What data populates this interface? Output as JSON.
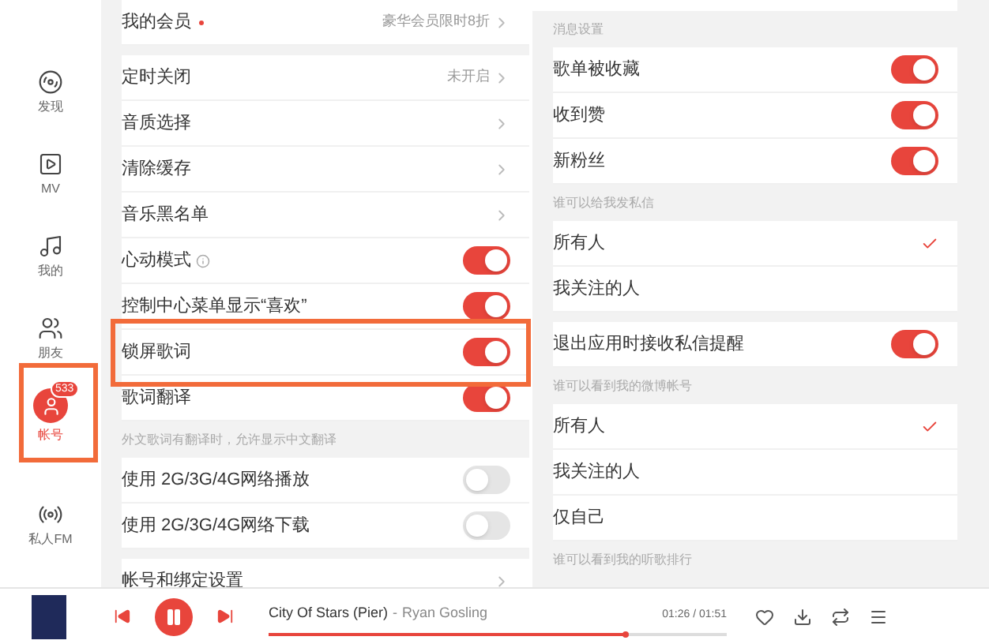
{
  "sidebar": {
    "items": [
      {
        "label": "发现",
        "selected": false
      },
      {
        "label": "MV",
        "selected": false
      },
      {
        "label": "我的",
        "selected": false
      },
      {
        "label": "朋友",
        "selected": false
      },
      {
        "label": "帐号",
        "selected": true,
        "badge": "533"
      },
      {
        "label": "私人FM",
        "selected": false
      }
    ]
  },
  "settings_left": {
    "sections": [
      {
        "rows": [
          {
            "kind": "link",
            "label": "我的会员",
            "dot": true,
            "value": "豪华会员限时8折"
          }
        ]
      },
      {
        "rows": [
          {
            "kind": "link",
            "label": "定时关闭",
            "value": "未开启"
          },
          {
            "kind": "link",
            "label": "音质选择"
          },
          {
            "kind": "link",
            "label": "清除缓存"
          },
          {
            "kind": "link",
            "label": "音乐黑名单"
          },
          {
            "kind": "toggle",
            "label": "心动模式",
            "info": true,
            "on": true
          },
          {
            "kind": "toggle",
            "label": "控制中心菜单显示“喜欢”",
            "on": true
          },
          {
            "kind": "toggle",
            "label": "锁屏歌词",
            "on": true
          },
          {
            "kind": "toggle",
            "label": "歌词翻译",
            "on": true
          }
        ]
      },
      {
        "header": "外文歌词有翻译时，允许显示中文翻译",
        "rows": [
          {
            "kind": "toggle",
            "label": "使用 2G/3G/4G网络播放",
            "on": false
          },
          {
            "kind": "toggle",
            "label": "使用 2G/3G/4G网络下载",
            "on": false
          }
        ]
      },
      {
        "rows": [
          {
            "kind": "link",
            "label": "帐号和绑定设置"
          }
        ]
      }
    ]
  },
  "settings_right": {
    "sections": [
      {
        "header": "消息设置",
        "rows": [
          {
            "kind": "toggle",
            "label": "歌单被收藏",
            "on": true
          },
          {
            "kind": "toggle",
            "label": "收到赞",
            "on": true
          },
          {
            "kind": "toggle",
            "label": "新粉丝",
            "on": true
          }
        ]
      },
      {
        "header": "谁可以给我发私信",
        "rows": [
          {
            "kind": "choice",
            "label": "所有人",
            "selected": true
          },
          {
            "kind": "choice",
            "label": "我关注的人",
            "selected": false
          }
        ]
      },
      {
        "rows": [
          {
            "kind": "toggle",
            "label": "退出应用时接收私信提醒",
            "on": true
          }
        ]
      },
      {
        "header": "谁可以看到我的微博帐号",
        "rows": [
          {
            "kind": "choice",
            "label": "所有人",
            "selected": true
          },
          {
            "kind": "choice",
            "label": "我关注的人",
            "selected": false
          },
          {
            "kind": "choice",
            "label": "仅自己",
            "selected": false
          }
        ]
      },
      {
        "header": "谁可以看到我的听歌排行"
      }
    ]
  },
  "player": {
    "title": "City Of Stars (Pier)",
    "separator": "-",
    "artist": "Ryan Gosling",
    "time": "01:26 / 01:51",
    "playing": true,
    "level": 0.78
  }
}
